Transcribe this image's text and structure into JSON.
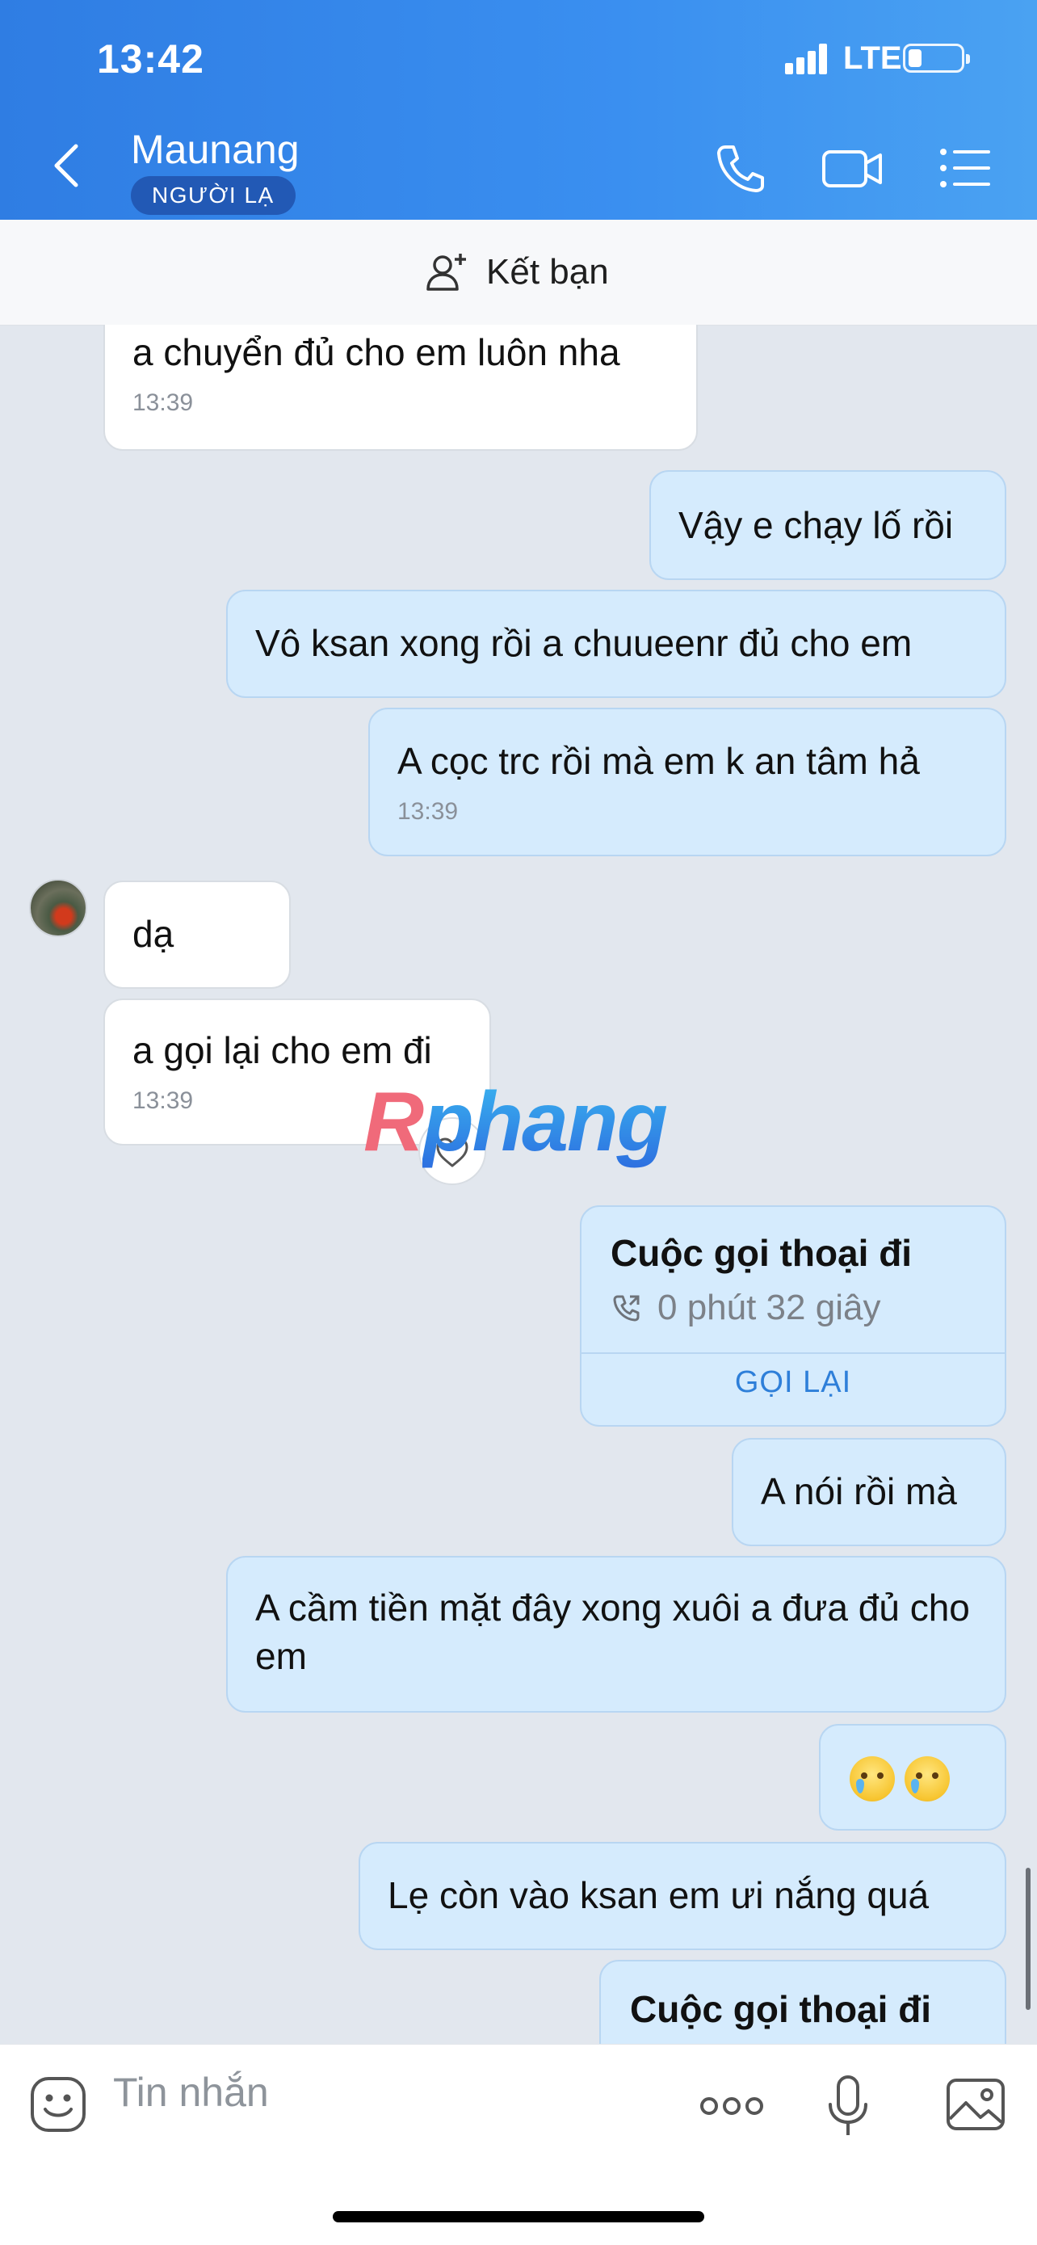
{
  "status_bar": {
    "time": "13:42",
    "network": "LTE"
  },
  "header": {
    "contact_name": "Maunang",
    "badge": "NGƯỜI LẠ",
    "icons": [
      "back-chevron-icon",
      "phone-icon",
      "video-call-icon",
      "menu-list-icon"
    ]
  },
  "friend_bar": {
    "label": "Kết bạn",
    "icon": "add-friend-icon"
  },
  "messages": [
    {
      "dir": "in",
      "text": "a chuyển đủ cho em luôn nha",
      "time": "13:39"
    },
    {
      "dir": "out",
      "text": "Vậy e chạy lố rồi"
    },
    {
      "dir": "out",
      "text": "Vô ksan xong rồi a chuueenr đủ cho em"
    },
    {
      "dir": "out",
      "text": "A cọc trc rồi mà em k an tâm hả",
      "time": "13:39"
    },
    {
      "dir": "in",
      "text": "dạ"
    },
    {
      "dir": "in",
      "text": "a gọi lại cho em đi",
      "time": "13:39"
    },
    {
      "dir": "out",
      "call_title": "Cuộc gọi thoại đi",
      "call_duration": "0 phút 32 giây",
      "action": "GỌI LẠI"
    },
    {
      "dir": "out",
      "text": "A nói rồi mà"
    },
    {
      "dir": "out",
      "text": "A cầm tiền mặt đây xong xuôi a đưa đủ cho em"
    },
    {
      "dir": "out",
      "emoji": "crying-face-emoji crying-face-emoji"
    },
    {
      "dir": "out",
      "text": "Lẹ còn vào ksan em ưi nắng quá"
    },
    {
      "dir": "out",
      "call_title": "Cuộc gọi thoại đi"
    }
  ],
  "reaction_icon": "heart-icon",
  "watermark": {
    "r": "R",
    "rest": "phang"
  },
  "composer": {
    "placeholder": "Tin nhắn",
    "icons": [
      "sticker-icon",
      "more-icon",
      "microphone-icon",
      "image-icon"
    ]
  },
  "colors": {
    "header_blue": "#2f7de3",
    "outgoing_bubble": "#d5ebfd",
    "incoming_bubble": "#ffffff",
    "chat_bg": "#e2e7ee",
    "accent_link": "#2e7fd9"
  }
}
